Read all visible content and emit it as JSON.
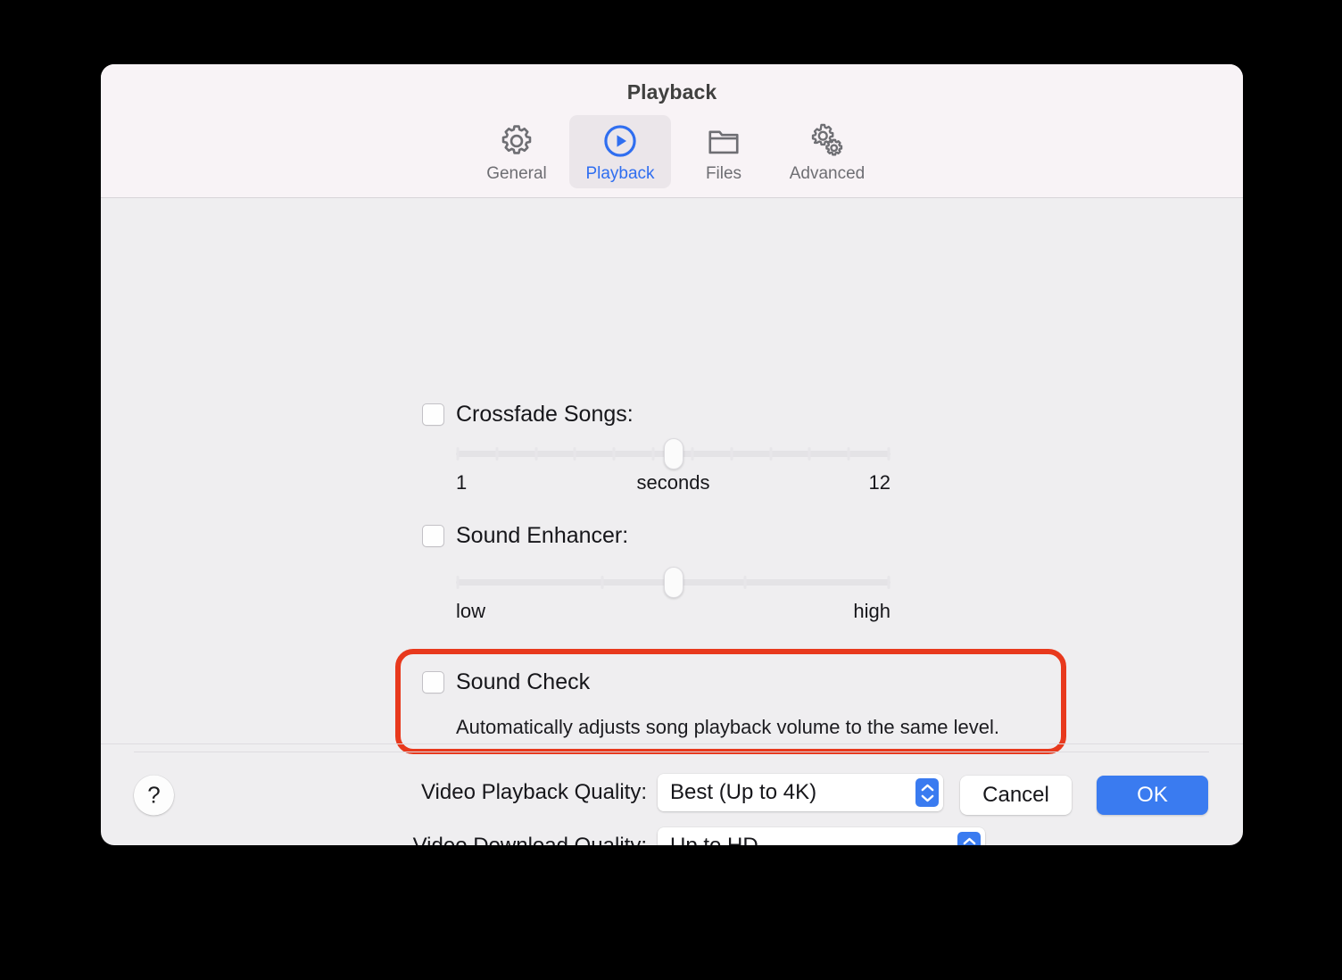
{
  "window": {
    "title": "Playback",
    "accent_color": "#3a7bf0",
    "highlight_color": "#e8391d",
    "header_background": "#f8f3f6",
    "body_background": "#efeef0"
  },
  "toolbar": {
    "tabs": [
      {
        "label": "General",
        "icon": "gear-icon",
        "selected": false
      },
      {
        "label": "Playback",
        "icon": "play-circle-icon",
        "selected": true
      },
      {
        "label": "Files",
        "icon": "folder-icon",
        "selected": false
      },
      {
        "label": "Advanced",
        "icon": "double-gear-icon",
        "selected": false
      }
    ]
  },
  "settings": {
    "crossfade": {
      "label": "Crossfade Songs:",
      "checked": false,
      "slider": {
        "min_label": "1",
        "unit_label": "seconds",
        "max_label": "12",
        "min": 1,
        "max": 12,
        "value": 6,
        "ticks": 12
      }
    },
    "sound_enhancer": {
      "label": "Sound Enhancer:",
      "checked": false,
      "slider": {
        "min_label": "low",
        "max_label": "high",
        "min": 0,
        "max": 100,
        "value": 50,
        "ticks": 4
      }
    },
    "sound_check": {
      "label": "Sound Check",
      "checked": false,
      "description": "Automatically adjusts song playback volume to the same level.",
      "highlighted": true
    },
    "video_playback_quality": {
      "label": "Video Playback Quality:",
      "value": "Best (Up to 4K)"
    },
    "video_download_quality": {
      "label": "Video Download Quality:",
      "value": "Up to HD"
    }
  },
  "footer": {
    "help_label": "?",
    "cancel_label": "Cancel",
    "ok_label": "OK"
  }
}
